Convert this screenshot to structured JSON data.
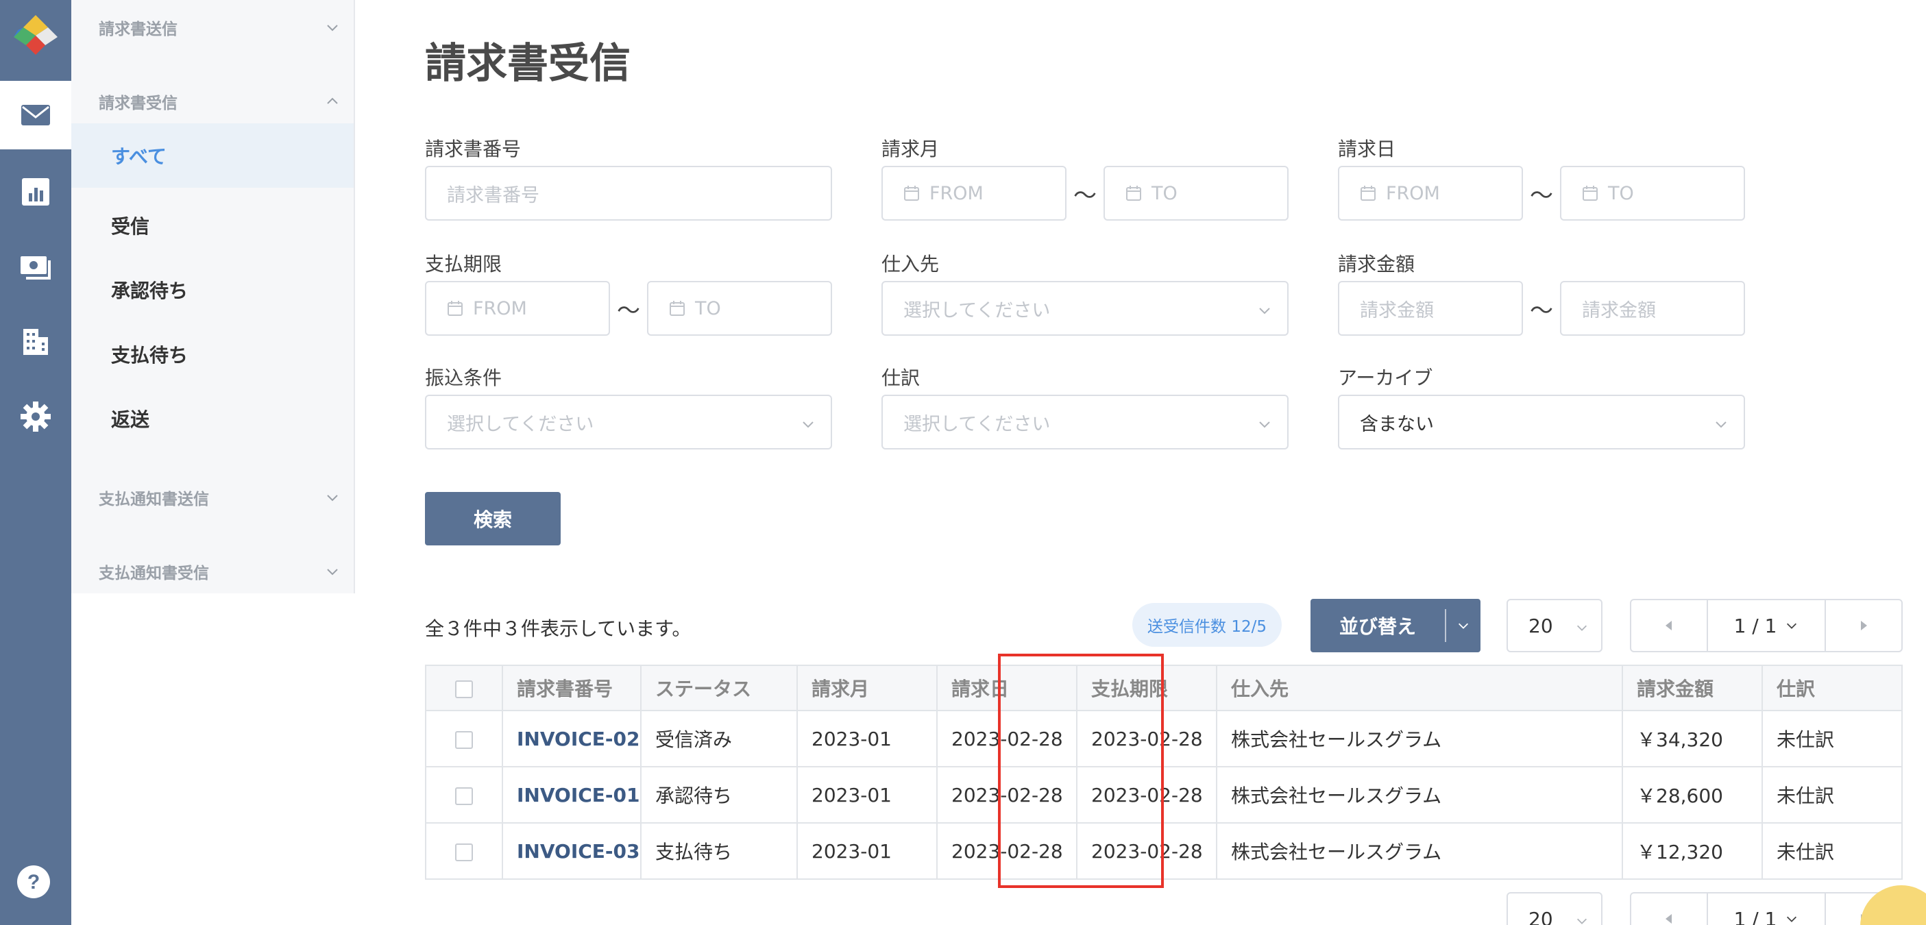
{
  "sidebar": {
    "sections": [
      {
        "label": "請求書送信",
        "expanded": false
      },
      {
        "label": "請求書受信",
        "expanded": true
      },
      {
        "label": "支払通知書送信",
        "expanded": false
      },
      {
        "label": "支払通知書受信",
        "expanded": false
      }
    ],
    "items": [
      {
        "label": "すべて",
        "active": true
      },
      {
        "label": "受信",
        "active": false
      },
      {
        "label": "承認待ち",
        "active": false
      },
      {
        "label": "支払待ち",
        "active": false
      },
      {
        "label": "返送",
        "active": false
      }
    ]
  },
  "rail": {
    "icons": [
      "logo-icon",
      "mail-icon",
      "chart-icon",
      "payment-icon",
      "building-icon",
      "gear-icon",
      "help-icon"
    ],
    "active": "mail-icon"
  },
  "page": {
    "title": "請求書受信"
  },
  "filters": {
    "invoice_number": {
      "label": "請求書番号",
      "placeholder": "請求書番号"
    },
    "billing_month": {
      "label": "請求月",
      "from": "FROM",
      "to": "TO"
    },
    "billing_date": {
      "label": "請求日",
      "from": "FROM",
      "to": "TO"
    },
    "due_date": {
      "label": "支払期限",
      "from": "FROM",
      "to": "TO"
    },
    "supplier": {
      "label": "仕入先",
      "placeholder": "選択してください"
    },
    "amount": {
      "label": "請求金額",
      "from_placeholder": "請求金額",
      "to_placeholder": "請求金額"
    },
    "transfer_terms": {
      "label": "振込条件",
      "placeholder": "選択してください"
    },
    "journal": {
      "label": "仕訳",
      "placeholder": "選択してください"
    },
    "archive": {
      "label": "アーカイブ",
      "value": "含まない"
    },
    "range_sep": "〜",
    "search_button": "検索"
  },
  "results": {
    "summary": "全３件中３件表示しています。",
    "badge": "送受信件数 12/5",
    "sort_label": "並び替え",
    "per_page": "20",
    "page": "1 / 1"
  },
  "table": {
    "columns": [
      "請求書番号",
      "ステータス",
      "請求月",
      "請求日",
      "支払期限",
      "仕入先",
      "請求金額",
      "仕訳"
    ],
    "rows": [
      {
        "invoice": "INVOICE-02",
        "status": "受信済み",
        "month": "2023-01",
        "date": "2023-02-28",
        "due": "2023-02-28",
        "supplier": "株式会社セールスグラム",
        "amount": "￥34,320",
        "journal": "未仕訳"
      },
      {
        "invoice": "INVOICE-01",
        "status": "承認待ち",
        "month": "2023-01",
        "date": "2023-02-28",
        "due": "2023-02-28",
        "supplier": "株式会社セールスグラム",
        "amount": "￥28,600",
        "journal": "未仕訳"
      },
      {
        "invoice": "INVOICE-03",
        "status": "支払待ち",
        "month": "2023-01",
        "date": "2023-02-28",
        "due": "2023-02-28",
        "supplier": "株式会社セールスグラム",
        "amount": "￥12,320",
        "journal": "未仕訳"
      }
    ]
  },
  "colors": {
    "rail": "#5a7294",
    "accent": "#4a8fe0",
    "highlight": "#e8332a",
    "button": "#5a7294"
  }
}
